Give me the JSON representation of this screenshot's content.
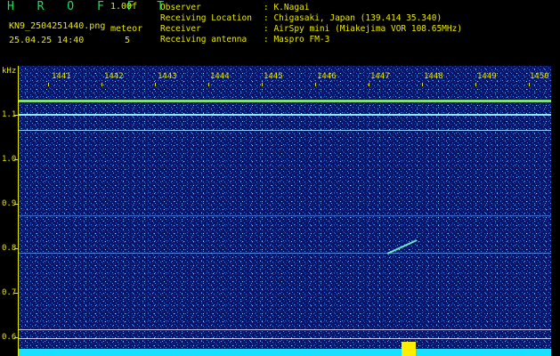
{
  "header": {
    "app_title": "H R O F F T",
    "version": "1.00f",
    "filename": "KN9_2504251440.png",
    "datetime": "25.04.25 14:40",
    "meteor_label": "meteor",
    "meteor_count": "5"
  },
  "info": [
    {
      "key": "Observer",
      "value": ": K.Nagai"
    },
    {
      "key": "Receiving Location",
      "value": ": Chigasaki, Japan (139.414 35.340)"
    },
    {
      "key": "Receiver",
      "value": ": AirSpy mini (Miakejima VOR 108.65MHz)"
    },
    {
      "key": "Receiving antenna",
      "value": ": Maspro FM-3"
    }
  ],
  "axis": {
    "y_unit": "kHz",
    "y_ticks": [
      "1.1",
      "1.0",
      "0.9",
      "0.8",
      "0.7",
      "0.6"
    ],
    "x_ticks": [
      "1441",
      "1442",
      "1443",
      "1444",
      "1445",
      "1446",
      "1447",
      "1448",
      "1449",
      "1450"
    ]
  },
  "colors": {
    "background": "#000000",
    "spectrogram_bg": "#0b1466",
    "label": "#e8e800",
    "title": "#19e05a",
    "signal": "#00e5ff",
    "burst": "#ffee00"
  }
}
